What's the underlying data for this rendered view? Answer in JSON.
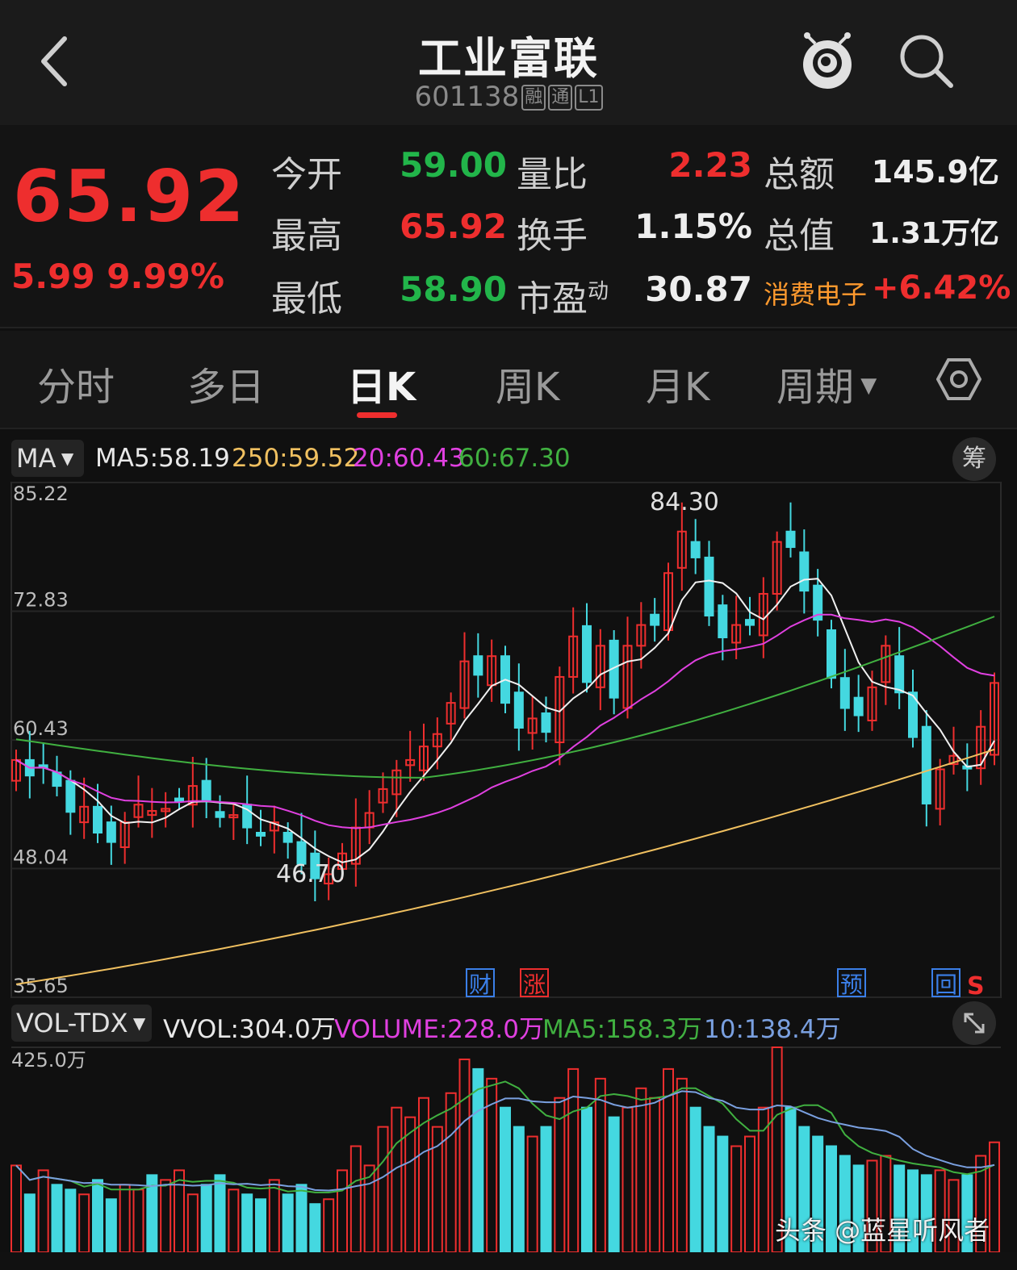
{
  "header": {
    "title": "工业富联",
    "code": "601138",
    "tags": [
      "融",
      "通",
      "L1"
    ]
  },
  "quote": {
    "price": "65.92",
    "change": "5.99",
    "change_pct": "9.99%",
    "rows": [
      {
        "label1": "今开",
        "value1": "59.00",
        "label2": "量比",
        "value2": "2.23",
        "label3": "总额",
        "value3": "145.9亿"
      },
      {
        "label1": "最高",
        "value1": "65.92",
        "label2": "换手",
        "value2": "1.15%",
        "label3": "总值",
        "value3": "1.31万亿"
      },
      {
        "label1": "最低",
        "value1": "58.90",
        "label2": "市盈",
        "label2_sup": "动",
        "value2": "30.87",
        "label3": "消费电子",
        "value3": "+6.42%"
      }
    ]
  },
  "tabs": [
    "分时",
    "多日",
    "日K",
    "周K",
    "月K",
    "周期"
  ],
  "active_tab": "日K",
  "ma_legend": {
    "select": "MA",
    "ma5": "MA5:58.19",
    "ma250": "250:59.52",
    "ma20": "20:60.43",
    "ma60": "60:67.30",
    "chou": "筹"
  },
  "vol_legend": {
    "select": "VOL-TDX",
    "vvol": "VVOL:304.0万",
    "volume": "VOLUME:228.0万",
    "ma5": "MA5:158.3万",
    "ma10": "10:138.4万"
  },
  "chart_data": {
    "type": "candlestick",
    "y_ticks": [
      "85.22",
      "72.83",
      "60.43",
      "48.04",
      "35.65"
    ],
    "ylim": [
      35.65,
      85.22
    ],
    "high_label": "84.30",
    "low_label": "46.70",
    "events": [
      "财",
      "涨",
      "预",
      "回",
      "S"
    ],
    "ma_series": [
      {
        "name": "MA5",
        "color": "#f0f0f0",
        "last": 58.19
      },
      {
        "name": "250",
        "color": "#f0c060",
        "last": 59.52
      },
      {
        "name": "20",
        "color": "#e040e0",
        "last": 60.43
      },
      {
        "name": "60",
        "color": "#40b040",
        "last": 67.3
      }
    ],
    "close_series": [
      58.5,
      57,
      57.8,
      56,
      53.5,
      54,
      51.5,
      50.6,
      52.5,
      54.2,
      53.6,
      53.8,
      54.7,
      56,
      54.5,
      53,
      53.2,
      52,
      51.2,
      52.5,
      50.6,
      48.5,
      47.1,
      47.5,
      49.5,
      52,
      53.4,
      55.7,
      57.5,
      58.5,
      59.8,
      61,
      64,
      68,
      66.7,
      68.5,
      64,
      61.6,
      62.5,
      61.2,
      66.5,
      70.4,
      66,
      69.5,
      64.5,
      69.5,
      71.5,
      71.5,
      76.5,
      80.5,
      78,
      72.4,
      70.3,
      71.5,
      71.5,
      74.5,
      79.5,
      79,
      74.8,
      72,
      66.4,
      63.5,
      62.8,
      65.5,
      69.5,
      65,
      60.7,
      54.3,
      57.6,
      58.9,
      57.7,
      61.7,
      65.92
    ],
    "vol_ylim": [
      0,
      425
    ],
    "vol_top_label": "425.0万",
    "volume_series": [
      180,
      120,
      170,
      140,
      130,
      120,
      150,
      110,
      140,
      130,
      160,
      150,
      170,
      120,
      140,
      160,
      130,
      120,
      110,
      150,
      120,
      140,
      100,
      110,
      170,
      220,
      180,
      260,
      300,
      280,
      320,
      260,
      330,
      400,
      380,
      360,
      300,
      260,
      240,
      260,
      320,
      380,
      300,
      360,
      280,
      300,
      340,
      320,
      380,
      360,
      300,
      260,
      240,
      220,
      240,
      300,
      425,
      300,
      260,
      240,
      220,
      200,
      180,
      190,
      200,
      180,
      170,
      160,
      170,
      150,
      160,
      200,
      228
    ]
  },
  "watermark": "头条 @蓝星听风者"
}
